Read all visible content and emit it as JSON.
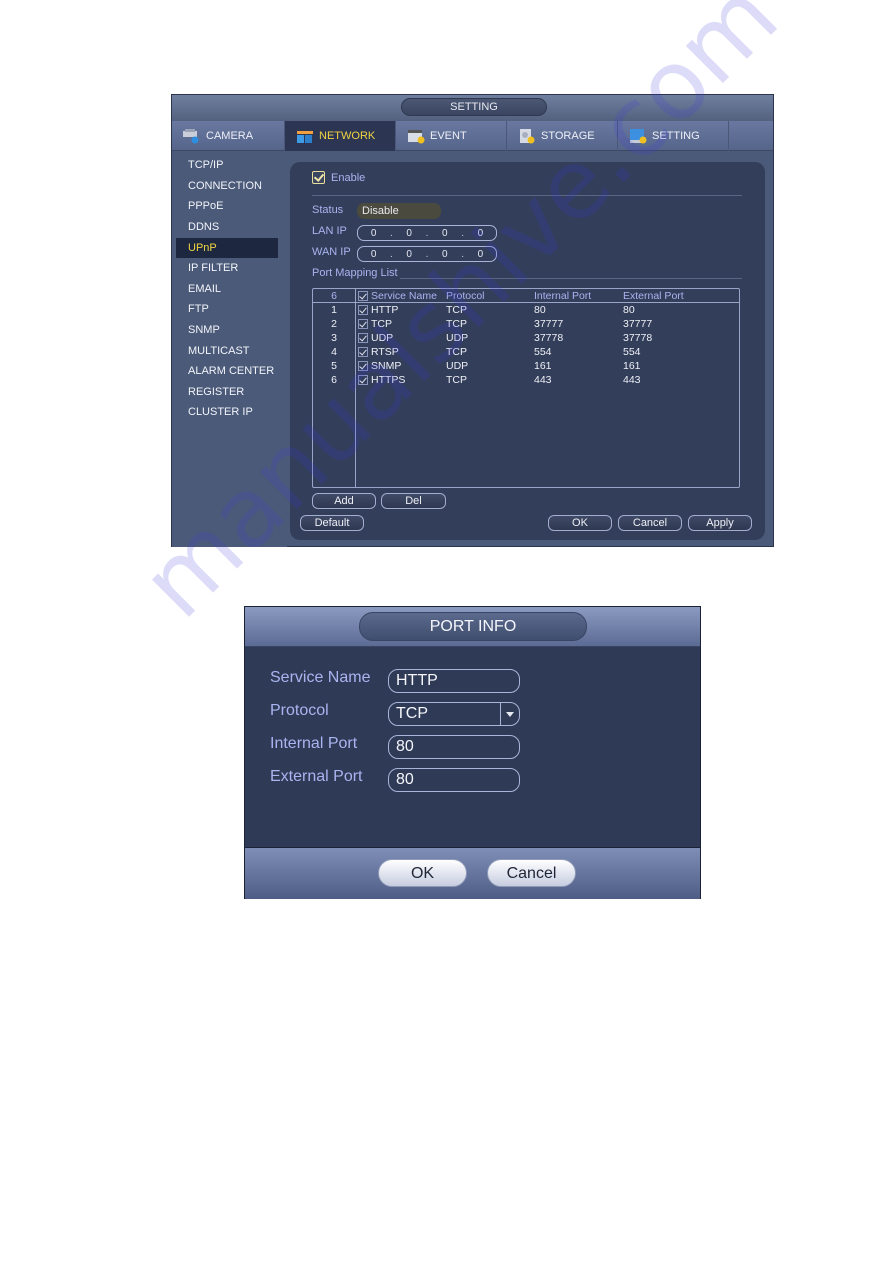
{
  "settings_window": {
    "title": "SETTING",
    "tabs": [
      {
        "label": "CAMERA",
        "icon": "camera-icon",
        "active": false
      },
      {
        "label": "NETWORK",
        "icon": "network-icon",
        "active": true
      },
      {
        "label": "EVENT",
        "icon": "event-icon",
        "active": false
      },
      {
        "label": "STORAGE",
        "icon": "storage-icon",
        "active": false
      },
      {
        "label": "SETTING",
        "icon": "monitor-settings-icon",
        "active": false
      }
    ],
    "sidebar": {
      "items": [
        {
          "label": "TCP/IP"
        },
        {
          "label": "CONNECTION"
        },
        {
          "label": "PPPoE"
        },
        {
          "label": "DDNS"
        },
        {
          "label": "UPnP",
          "active": true
        },
        {
          "label": "IP FILTER"
        },
        {
          "label": "EMAIL"
        },
        {
          "label": "FTP"
        },
        {
          "label": "SNMP"
        },
        {
          "label": "MULTICAST"
        },
        {
          "label": "ALARM CENTER"
        },
        {
          "label": "REGISTER"
        },
        {
          "label": "CLUSTER IP"
        }
      ]
    },
    "upnp": {
      "enable_label": "Enable",
      "enable_checked": true,
      "status_label": "Status",
      "status_value": "Disable",
      "lan_ip_label": "LAN IP",
      "lan_ip": [
        "0",
        "0",
        "0",
        "0"
      ],
      "wan_ip_label": "WAN IP",
      "wan_ip": [
        "0",
        "0",
        "0",
        "0"
      ],
      "port_mapping_label": "Port Mapping List",
      "table": {
        "header": {
          "count": "6",
          "service_name": "Service Name",
          "protocol": "Protocol",
          "internal_port": "Internal Port",
          "external_port": "External Port"
        },
        "rows": [
          {
            "idx": "1",
            "checked": true,
            "service_name": "HTTP",
            "protocol": "TCP",
            "internal_port": "80",
            "external_port": "80"
          },
          {
            "idx": "2",
            "checked": true,
            "service_name": "TCP",
            "protocol": "TCP",
            "internal_port": "37777",
            "external_port": "37777"
          },
          {
            "idx": "3",
            "checked": true,
            "service_name": "UDP",
            "protocol": "UDP",
            "internal_port": "37778",
            "external_port": "37778"
          },
          {
            "idx": "4",
            "checked": true,
            "service_name": "RTSP",
            "protocol": "TCP",
            "internal_port": "554",
            "external_port": "554"
          },
          {
            "idx": "5",
            "checked": true,
            "service_name": "SNMP",
            "protocol": "UDP",
            "internal_port": "161",
            "external_port": "161"
          },
          {
            "idx": "6",
            "checked": true,
            "service_name": "HTTPS",
            "protocol": "TCP",
            "internal_port": "443",
            "external_port": "443"
          }
        ]
      },
      "buttons": {
        "add": "Add",
        "del": "Del",
        "default": "Default",
        "ok": "OK",
        "cancel": "Cancel",
        "apply": "Apply"
      }
    }
  },
  "port_info_dialog": {
    "title": "PORT INFO",
    "service_name_label": "Service Name",
    "service_name_value": "HTTP",
    "protocol_label": "Protocol",
    "protocol_value": "TCP",
    "internal_port_label": "Internal Port",
    "internal_port_value": "80",
    "external_port_label": "External Port",
    "external_port_value": "80",
    "buttons": {
      "ok": "OK",
      "cancel": "Cancel"
    }
  },
  "watermark": "manualshive.com",
  "colors": {
    "active_accent": "#f0d442",
    "label_blue": "#aab4f0",
    "panel_bg": "#333e5a"
  }
}
